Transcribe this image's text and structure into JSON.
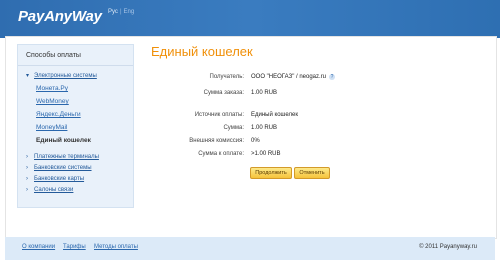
{
  "header": {
    "logo": "PayAnyWay",
    "lang_ru": "Рус",
    "lang_sep": "|",
    "lang_en": "Eng",
    "bg_color": "#2e6fb2"
  },
  "sidebar": {
    "title": "Способы оплаты",
    "groups": [
      {
        "label": "Электронные системы",
        "arrow": "▾",
        "items": [
          "Монета.Ру",
          "WebMoney",
          "Яндекс.Деньги",
          "MoneyMail",
          "Единый кошелек"
        ],
        "active": "Единый кошелек"
      },
      {
        "label": "Платежные терминалы",
        "arrow": "›"
      },
      {
        "label": "Банковские системы",
        "arrow": "›"
      },
      {
        "label": "Банковские карты",
        "arrow": "›"
      },
      {
        "label": "Салоны связи",
        "arrow": "›"
      }
    ]
  },
  "main": {
    "title": "Единый кошелек",
    "title_color": "#f0900a",
    "fields": [
      {
        "label": "Получатель:",
        "value": "ООО \"НЕОГАЗ\" / neogaz.ru",
        "help": "?"
      },
      {
        "label": "Сумма заказа:",
        "value": "1.00 RUB"
      },
      {
        "label": "Источник оплаты:",
        "value": "Единый кошелек"
      },
      {
        "label": "Сумма:",
        "value": "1.00 RUB"
      },
      {
        "label": "Внешняя комиссия:",
        "value": "0%"
      },
      {
        "label": "Сумма к оплате:",
        "value": ">1.00 RUB"
      }
    ],
    "buttons": {
      "continue": "Продолжить",
      "cancel": "Отменить"
    }
  },
  "footer": {
    "links": [
      "О компании",
      "Тарифы",
      "Методы оплаты"
    ],
    "copyright": "© 2011 Payanyway.ru"
  }
}
